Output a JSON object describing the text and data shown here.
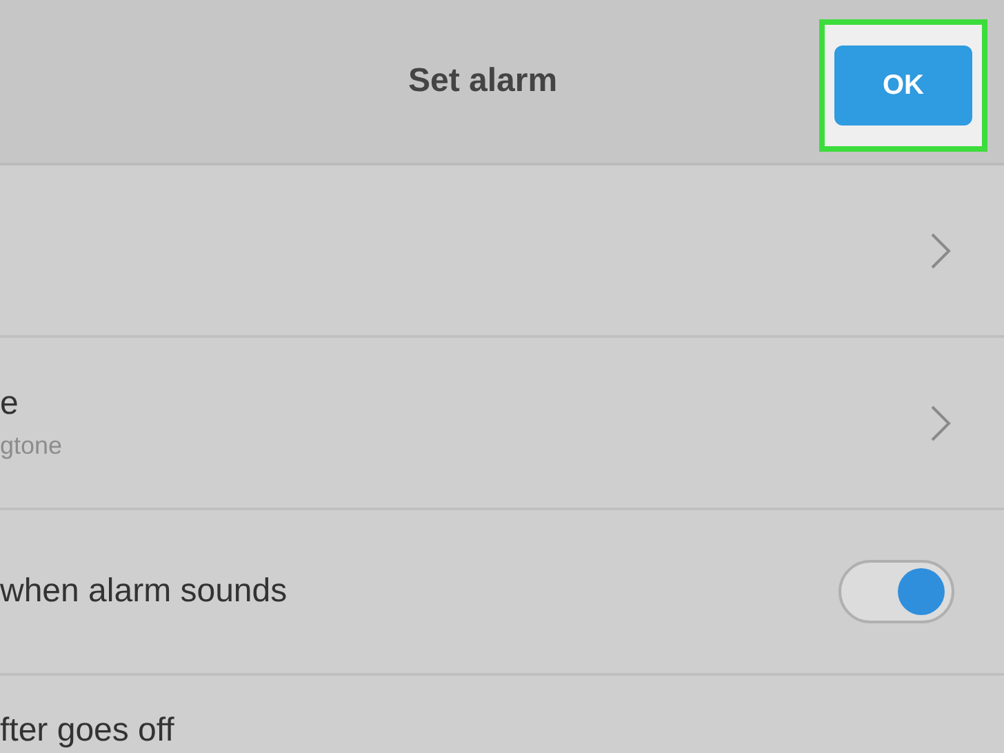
{
  "header": {
    "title": "Set alarm",
    "ok_button": {
      "label": "OK",
      "highlighted": true
    }
  },
  "rows": [
    {
      "kind": "chevron"
    },
    {
      "kind": "chevron",
      "title": "e",
      "subtitle": "gtone"
    },
    {
      "kind": "toggle",
      "title": "when alarm sounds",
      "on": true
    },
    {
      "kind": "plain",
      "title": "fter goes off"
    }
  ]
}
